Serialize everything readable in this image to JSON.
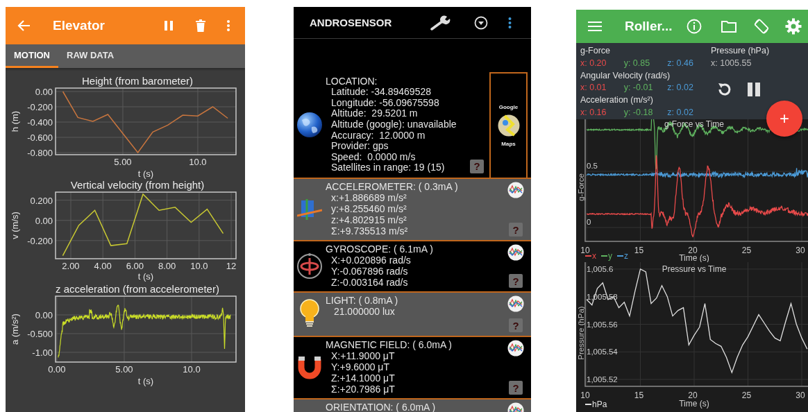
{
  "left_screen": {
    "title": "Elevator",
    "tabs": [
      {
        "label": "MOTION",
        "selected": true
      },
      {
        "label": "RAW DATA",
        "selected": false
      }
    ],
    "charts": [
      {
        "kind": "plot",
        "chart_data": {
          "type": "line",
          "grid": true,
          "title": "Height (from barometer)",
          "xlabel": "t (s)",
          "ylabel": "h (m)",
          "x": [
            1,
            2,
            3,
            4,
            5,
            6,
            7,
            8,
            9,
            10,
            11,
            12
          ],
          "series": [
            {
              "color": "#c8753e",
              "values": [
                0,
                -0.34,
                -0.39,
                -0.3,
                -0.55,
                -0.8,
                -0.53,
                -0.44,
                -0.31,
                -0.32,
                -0.2,
                -0.35
              ]
            }
          ],
          "xlim": [
            0.51,
            12.55
          ],
          "ylim": [
            -0.827,
            0.045
          ],
          "xticks": [
            {
              "value": 5,
              "label": "5.00"
            },
            {
              "value": 10,
              "label": "10.0"
            }
          ],
          "yticks": [
            {
              "value": 0,
              "label": "0.00"
            },
            {
              "value": -0.2,
              "label": "-0.200"
            },
            {
              "value": -0.4,
              "label": "-0.400"
            },
            {
              "value": -0.6,
              "label": "-0.600"
            },
            {
              "value": -0.8,
              "label": "-0.800"
            }
          ]
        }
      },
      {
        "kind": "plot",
        "chart_data": {
          "type": "line",
          "grid": true,
          "title": "Vertical velocity (from height)",
          "xlabel": "t (s)",
          "ylabel": "v (m/s)",
          "x": [
            1.5,
            2.5,
            3.5,
            4.5,
            5.5,
            6.5,
            7.5,
            8.5,
            9.5,
            10.5,
            11.5
          ],
          "series": [
            {
              "color": "#c8c832",
              "values": [
                -0.35,
                -0.05,
                0.1,
                -0.25,
                -0.23,
                0.26,
                0.1,
                0.13,
                -0.02,
                0.11,
                -0.13
              ]
            }
          ],
          "xlim": [
            1.05,
            12.3
          ],
          "ylim": [
            -0.38,
            0.28
          ],
          "xticks": [
            {
              "value": 2,
              "label": "2.00"
            },
            {
              "value": 4,
              "label": "4.00"
            },
            {
              "value": 6,
              "label": "6.00"
            },
            {
              "value": 8,
              "label": "8.00"
            },
            {
              "value": 10,
              "label": "10.0"
            },
            {
              "value": 12,
              "label": "12"
            }
          ],
          "yticks": [
            {
              "value": 0.2,
              "label": "0.200"
            },
            {
              "value": 0,
              "label": "0.00"
            },
            {
              "value": -0.2,
              "label": "-0.200"
            }
          ]
        }
      },
      {
        "kind": "trace",
        "title": "z acceleration (from accelerometer)",
        "xlabel": "t (s)",
        "ylabel": "a (m/s²)",
        "xticks": [
          "0.00",
          "5.00",
          "10.0"
        ],
        "yticks": [
          "0.00",
          "-0.500",
          "-1.00"
        ]
      }
    ]
  },
  "middle_screen": {
    "title": "ANDROSENSOR",
    "location": {
      "heading": "LOCATION:",
      "lines": [
        "Latitude: -34.89469528",
        "Longitude: -56.09675598",
        "Altitude:  29.5201 m",
        "Altitude (google): unavailable",
        "Accuracy:  12.0000 m",
        "Provider: gps",
        "Speed:  0.0000 m/s",
        "Satellites in range: 19 (15)"
      ],
      "help": "?",
      "maps_button": {
        "top": "Google",
        "bottom": "Maps"
      }
    },
    "sensors": [
      {
        "kind": "accelerometer",
        "title": "ACCELEROMETER: ( 0.3mA )",
        "lines": [
          "x:+1.886689 m/s²",
          "y:+8.255460 m/s²",
          "z:+4.802915 m/s²",
          "Σ:+9.735513 m/s²"
        ],
        "help": "?"
      },
      {
        "kind": "gyroscope",
        "title": "GYROSCOPE: ( 6.1mA )",
        "lines": [
          "X:+0.020896 rad/s",
          "Y:-0.067896 rad/s",
          "Z:-0.003164 rad/s"
        ],
        "help": "?"
      },
      {
        "kind": "light",
        "title": "LIGHT: ( 0.8mA )",
        "lines": [
          " 21.000000 lux"
        ],
        "help": "?"
      },
      {
        "kind": "magnetic",
        "title": "MAGNETIC FIELD: ( 6.0mA )",
        "lines": [
          "X:+11.9000 μT",
          "Y:+9.6000 μT",
          "Z:+14.1000 μT",
          "Σ:+20.7986 μT"
        ],
        "help": "?"
      },
      {
        "kind": "orientation",
        "title": "ORIENTATION: ( 6.0mA )"
      }
    ]
  },
  "right_screen": {
    "title": "Roller...",
    "readouts": [
      {
        "label": "g-Force",
        "values": [
          {
            "text": "x: 0.20",
            "color": "#e84a4a"
          },
          {
            "text": "y: 0.85",
            "color": "#5fb35f"
          },
          {
            "text": "z: 0.46",
            "color": "#4b9ad6"
          }
        ]
      },
      {
        "label": "Angular Velocity (rad/s)",
        "values": [
          {
            "text": "x: 0.01",
            "color": "#e84a4a"
          },
          {
            "text": "y: -0.01",
            "color": "#5fb35f"
          },
          {
            "text": "z: 0.02",
            "color": "#4b9ad6"
          }
        ]
      },
      {
        "label": "Acceleration (m/s²)",
        "values": [
          {
            "text": "x: 0.16",
            "color": "#e84a4a"
          },
          {
            "text": "y: -0.18",
            "color": "#5fb35f"
          },
          {
            "text": "z: 0.02",
            "color": "#4b9ad6"
          }
        ]
      }
    ],
    "pressure": {
      "label": "Pressure (hPa)",
      "value": "x: 1005.55"
    },
    "fab": "+",
    "charts": [
      {
        "kind": "gforce",
        "title": "g-Force vs Time",
        "ylabel": "g-Force",
        "xlabel": "Time (s)",
        "xticks": [
          "10",
          "15",
          "20",
          "25",
          "30"
        ],
        "yticks": [
          "0.5",
          "0"
        ],
        "legend": [
          {
            "text": "x",
            "color": "#e84a4a"
          },
          {
            "text": "y",
            "color": "#5fb35f"
          },
          {
            "text": "z",
            "color": "#4b9ad6"
          }
        ]
      },
      {
        "kind": "pressure",
        "chart_data": {
          "type": "line",
          "grid": true,
          "title": "Pressure vs Time",
          "xlabel": "Time (s)",
          "ylabel": "Pressure (hPa)",
          "x": [
            10,
            10.5,
            11,
            11.5,
            12,
            12.5,
            13,
            13.5,
            14,
            14.5,
            15,
            15.5,
            16,
            16.5,
            17,
            17.5,
            18,
            18.5,
            19,
            19.5,
            20,
            20.5,
            21,
            21.5,
            22,
            22.5,
            23,
            23.5,
            24,
            24.5,
            25,
            25.5,
            26,
            26.5,
            27,
            27.5,
            28,
            28.5,
            29,
            29.5,
            30,
            30.5
          ],
          "series": [
            {
              "name": "hPa",
              "color": "#e0e0e0",
              "values": [
                1005.578,
                1005.574,
                1005.586,
                1005.59,
                1005.578,
                1005.58,
                1005.572,
                1005.576,
                1005.566,
                1005.584,
                1005.6,
                1005.598,
                1005.575,
                1005.579,
                1005.588,
                1005.58,
                1005.566,
                1005.57,
                1005.572,
                1005.545,
                1005.552,
                1005.558,
                1005.575,
                1005.549,
                1005.546,
                1005.544,
                1005.536,
                1005.525,
                1005.536,
                1005.545,
                1005.551,
                1005.559,
                1005.567,
                1005.561,
                1005.555,
                1005.55,
                1005.548,
                1005.562,
                1005.575,
                1005.56,
                1005.55,
                1005.542
              ]
            }
          ],
          "xlim": [
            9.87,
            30.58
          ],
          "ylim": [
            1005.515,
            1005.605
          ],
          "xticks": [
            {
              "value": 10,
              "label": "10"
            },
            {
              "value": 15,
              "label": "15"
            },
            {
              "value": 20,
              "label": "20"
            },
            {
              "value": 25,
              "label": "25"
            },
            {
              "value": 30,
              "label": "30"
            }
          ],
          "yticks": [
            {
              "value": 1005.6,
              "label": "1,005.6"
            },
            {
              "value": 1005.58,
              "label": "1,005.58"
            },
            {
              "value": 1005.56,
              "label": "1,005.56"
            },
            {
              "value": 1005.54,
              "label": "1,005.54"
            },
            {
              "value": 1005.52,
              "label": "1,005.52"
            }
          ]
        }
      }
    ]
  }
}
